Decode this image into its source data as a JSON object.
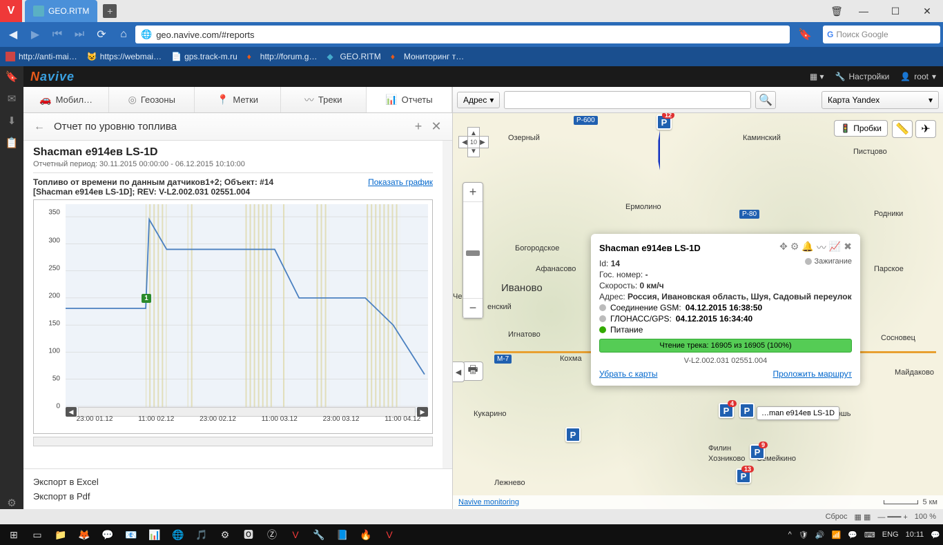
{
  "browser": {
    "tab_title": "GEO.RITM",
    "url": "geo.navive.com/#reports",
    "search_placeholder": "Поиск Google",
    "bookmarks": [
      "http://anti-mai…",
      "https://webmai…",
      "gps.track-m.ru",
      "http://forum.g…",
      "GEO.RITM",
      "Мониторинг т…"
    ],
    "status_zoom": "100 %",
    "status_reset": "Сброс"
  },
  "app": {
    "logo_text": "avive",
    "settings": "Настройки",
    "user": "root",
    "tabs": {
      "mobile": "Мобил…",
      "geozones": "Геозоны",
      "labels": "Метки",
      "tracks": "Треки",
      "reports": "Отчеты"
    },
    "subhead": {
      "title": "Отчет по уровню топлива"
    },
    "report": {
      "title": "Shacman е914ев LS-1D",
      "period": "Отчетный период: 30.11.2015 00:00:00 - 06.12.2015 10:10:00",
      "chart_title_1": "Топливо от времени по данным датчиков1+2; Объект: #14",
      "chart_title_2": "[Shacman е914ев LS-1D]; REV: V-L2.002.031 02551.004",
      "show_chart": "Показать график",
      "export_excel": "Экспорт в Excel",
      "export_pdf": "Экспорт в Pdf"
    },
    "map_toolbar": {
      "address": "Адрес",
      "maptype": "Карта Yandex",
      "traffic": "Пробки"
    },
    "popup": {
      "title": "Shacman е914ев LS-1D",
      "id_label": "Id:",
      "id_val": "14",
      "plate_label": "Гос. номер:",
      "plate_val": "-",
      "speed_label": "Скорость:",
      "speed_val": "0 км/ч",
      "addr_label": "Адрес:",
      "addr_val": "Россия, Ивановская область, Шуя, Садовый переулок",
      "gsm_label": "Соединение GSM:",
      "gsm_val": "04.12.2015 16:38:50",
      "gps_label": "ГЛОНАСС/GPS:",
      "gps_val": "04.12.2015 16:34:40",
      "power": "Питание",
      "ignition": "Зажигание",
      "progress": "Чтение трека: 16905 из 16905 (100%)",
      "version": "V-L2.002.031 02551.004",
      "remove": "Убрать с карты",
      "route": "Проложить маршрут",
      "tooltip": "…man е914ев LS-1D"
    },
    "map": {
      "cities": [
        "Озерный",
        "Каминский",
        "Пистцово",
        "Ермолино",
        "Родники",
        "Богородское",
        "Афанасово",
        "Иваново",
        "Парское",
        "Черн",
        "енский",
        "Игнатово",
        "Кохма",
        "Сосновец",
        "Майдаково",
        "Кукарино",
        "Хозниково",
        "Семейкино",
        "Филин",
        "Лежнево",
        "устошь"
      ],
      "footer_link": "Navive monitoring",
      "scale": "5 км",
      "roads": [
        "Р-600",
        "Р-80",
        "М-7"
      ]
    }
  },
  "taskbar": {
    "lang": "ENG",
    "time": "10:11"
  },
  "chart_data": {
    "type": "line",
    "title": "Топливо от времени по данным датчиков1+2; Объект: #14 [Shacman е914ев LS-1D]; REV: V-L2.002.031 02551.004",
    "ylabel": "",
    "ylim": [
      0,
      360
    ],
    "yticks": [
      0,
      50,
      100,
      150,
      200,
      250,
      300,
      350
    ],
    "x_categories": [
      "23:00 01.12",
      "11:00 02.12",
      "23:00 02.12",
      "11:00 03.12",
      "23:00 03.12",
      "11:00 04.12"
    ],
    "series": [
      {
        "name": "fuel",
        "values": [
          {
            "t": "18:00 01.12",
            "v": 180
          },
          {
            "t": "06:00 02.12",
            "v": 180
          },
          {
            "t": "07:00 02.12",
            "v": 345
          },
          {
            "t": "08:30 02.12",
            "v": 290
          },
          {
            "t": "00:00 03.12",
            "v": 290
          },
          {
            "t": "11:00 03.12",
            "v": 200
          },
          {
            "t": "02:00 04.12",
            "v": 200
          },
          {
            "t": "09:00 04.12",
            "v": 150
          },
          {
            "t": "14:00 04.12",
            "v": 60
          }
        ]
      }
    ],
    "marker": {
      "label": "1",
      "t": "06:00 02.12",
      "v": 200
    }
  }
}
